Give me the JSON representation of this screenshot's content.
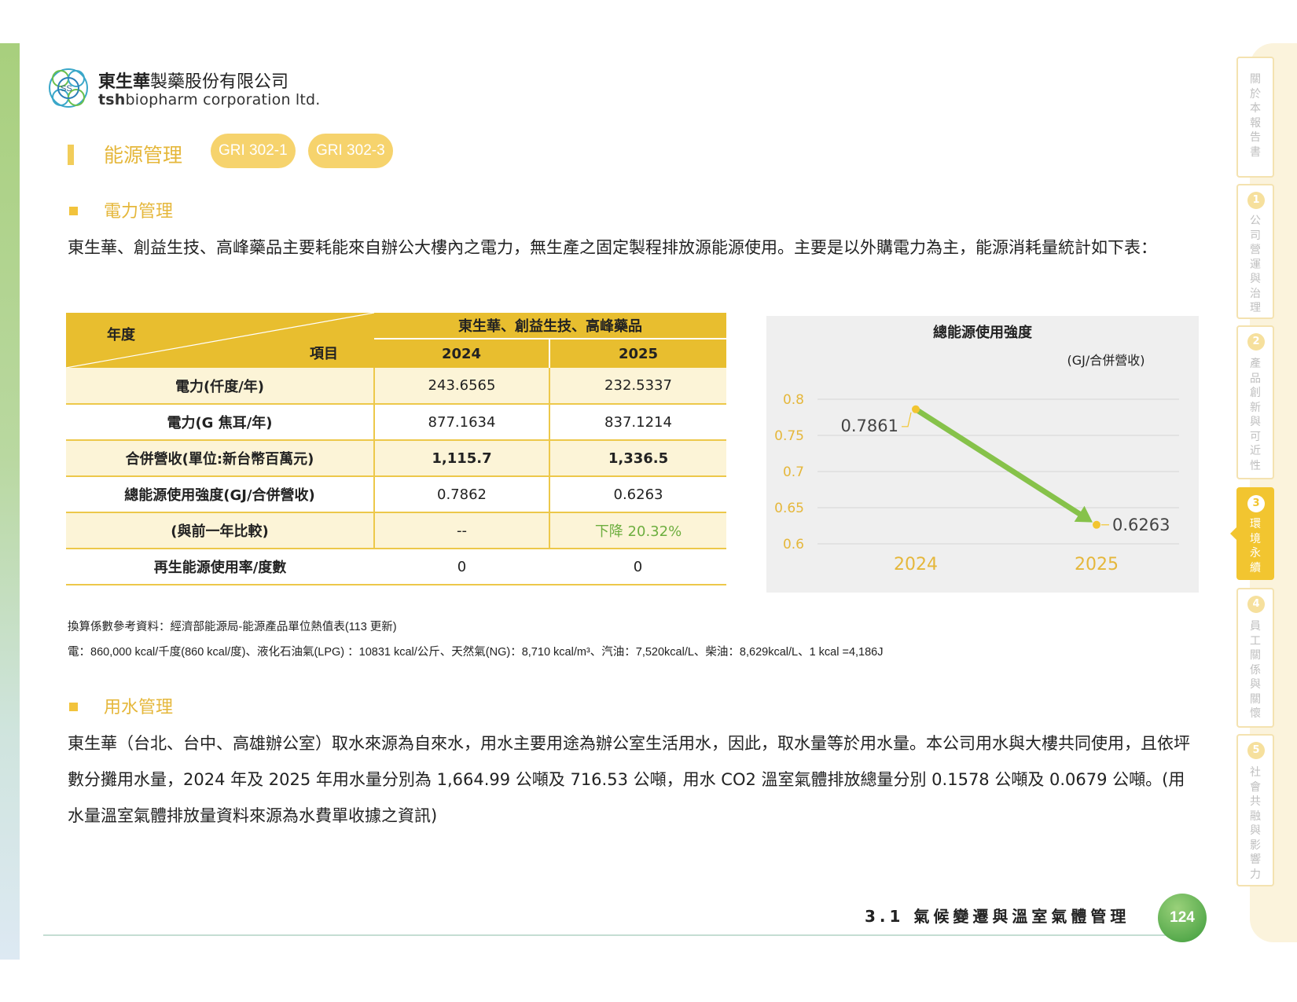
{
  "company": {
    "name_cn_bold": "東生華",
    "name_cn_rest": "製藥股份有限公司",
    "name_en_bold": "tsh",
    "name_en_rest": "biopharm corporation ltd.",
    "logo_mark": "SS"
  },
  "section": {
    "title": "能源管理",
    "badges": [
      "GRI 302-1",
      "GRI 302-3"
    ]
  },
  "power": {
    "heading": "電力管理",
    "paragraph": "東生華、創益生技、高峰藥品主要耗能來自辦公大樓內之電力，無生產之固定製程排放源能源使用。主要是以外購電力為主，能源消耗量統計如下表："
  },
  "table": {
    "corner_top": "年度",
    "corner_bottom": "項目",
    "group_header": "東生華、創益生技、高峰藥品",
    "years": [
      "2024",
      "2025"
    ],
    "rows": [
      {
        "label": "電力(仟度/年)",
        "v2024": "243.6565",
        "v2025": "232.5337"
      },
      {
        "label": "電力(G 焦耳/年)",
        "v2024": "877.1634",
        "v2025": "837.1214"
      },
      {
        "label": "合併營收(單位:新台幣百萬元)",
        "v2024": "1,115.7",
        "v2025": "1,336.5"
      },
      {
        "label": "總能源使用強度(GJ/合併營收)",
        "v2024": "0.7862",
        "v2025": "0.6263"
      },
      {
        "label": "(與前一年比較)",
        "v2024": "--",
        "v2025": "下降 20.32%"
      },
      {
        "label": "再生能源使用率/度數",
        "v2024": "0",
        "v2025": "0"
      }
    ]
  },
  "chart_data": {
    "type": "line",
    "title": "總能源使用強度",
    "unit_label": "(GJ/合併營收)",
    "categories": [
      "2024",
      "2025"
    ],
    "values": [
      0.7861,
      0.6263
    ],
    "data_labels": [
      "0.7861",
      "0.6263"
    ],
    "ylim": [
      0.6,
      0.8
    ],
    "yticks": [
      "0.8",
      "0.75",
      "0.7",
      "0.65",
      "0.6"
    ],
    "ytick_values": [
      0.8,
      0.75,
      0.7,
      0.65,
      0.6
    ],
    "grid": true,
    "colors": {
      "line": "#86c24a",
      "marker": "#f2c530",
      "tick": "#e5b73b",
      "background": "#efefef"
    }
  },
  "notes": {
    "line1": "換算係數參考資料：經濟部能源局-能源產品單位熱值表(113 更新)",
    "line2": "電：860,000 kcal/千度(860 kcal/度)、液化石油氣(LPG)  ：10831 kcal/公斤、天然氣(NG)：8,710 kcal/m³、汽油：7,520kcal/L、柴油：8,629kcal/L、1 kcal =4,186J"
  },
  "water": {
    "heading": "用水管理",
    "paragraph": "東生華（台北、台中、高雄辦公室）取水來源為自來水，用水主要用途為辦公室生活用水，因此，取水量等於用水量。本公司用水與大樓共同使用，且依坪數分攤用水量，2024 年及 2025 年用水量分別為 1,664.99 公噸及  716.53 公噸，用水 CO2 溫室氣體排放總量分別 0.1578 公噸及 0.0679 公噸。(用水量溫室氣體排放量資料來源為水費單收據之資訊)"
  },
  "nav_tabs": [
    {
      "num": "",
      "label": "關於本報告書",
      "active": false
    },
    {
      "num": "1",
      "label": "公司營運與治理",
      "active": false
    },
    {
      "num": "2",
      "label": "產品創新與可近性",
      "active": false
    },
    {
      "num": "3",
      "label": "環境永續",
      "active": true
    },
    {
      "num": "4",
      "label": "員工關係與關懷",
      "active": false
    },
    {
      "num": "5",
      "label": "社會共融與影響力",
      "active": false
    }
  ],
  "footer": {
    "chapter": "3.1  氣候變遷與溫室氣體管理",
    "page": "124"
  }
}
